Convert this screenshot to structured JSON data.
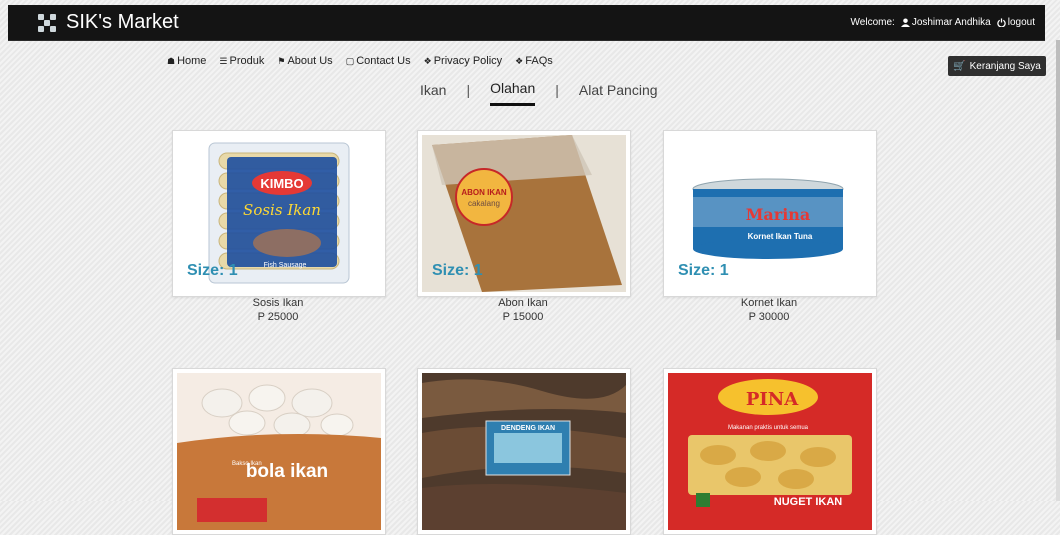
{
  "header": {
    "title": "SIK's Market",
    "welcome_label": "Welcome:",
    "user_name": "Joshimar Andhika",
    "logout_label": "logout"
  },
  "nav": [
    {
      "label": "Home",
      "icon": "home-icon"
    },
    {
      "label": "Produk",
      "icon": "list-icon"
    },
    {
      "label": "About Us",
      "icon": "bookmark-icon"
    },
    {
      "label": "Contact Us",
      "icon": "chat-icon"
    },
    {
      "label": "Privacy Policy",
      "icon": "info-icon"
    },
    {
      "label": "FAQs",
      "icon": "info-icon"
    }
  ],
  "cart_button": {
    "label": "Keranjang Saya",
    "icon": "cart-icon"
  },
  "tabs": [
    {
      "label": "Ikan",
      "active": false
    },
    {
      "label": "Olahan",
      "active": true
    },
    {
      "label": "Alat Pancing",
      "active": false
    }
  ],
  "products": [
    {
      "name": "Sosis Ikan",
      "price": "P 25000",
      "size_label": "Size: 1"
    },
    {
      "name": "Abon Ikan",
      "price": "P 15000",
      "size_label": "Size: 1"
    },
    {
      "name": "Kornet Ikan",
      "price": "P 30000",
      "size_label": "Size: 1"
    },
    {
      "name": "",
      "price": "",
      "size_label": ""
    },
    {
      "name": "",
      "price": "",
      "size_label": ""
    },
    {
      "name": "",
      "price": "",
      "size_label": ""
    }
  ],
  "package_text": {
    "kimbo": "KIMBO",
    "sosis": "Sosis Ikan",
    "fish_sausage": "Fish Sausage",
    "abon": "ABON IKAN",
    "cakalang": "cakalang",
    "marina": "Marina",
    "kornet": "Kornet Ikan Tuna",
    "bakso": "Bakso Ikan",
    "bola": "bola ikan",
    "dendeng": "DENDENG IKAN",
    "pina": "PINA",
    "pina_tagline": "Makanan praktis untuk semua",
    "nuget": "NUGET IKAN"
  },
  "colors": {
    "size_label": "#2f8fb2",
    "topbar": "#141414",
    "cart_button": "#2f2f2f"
  }
}
